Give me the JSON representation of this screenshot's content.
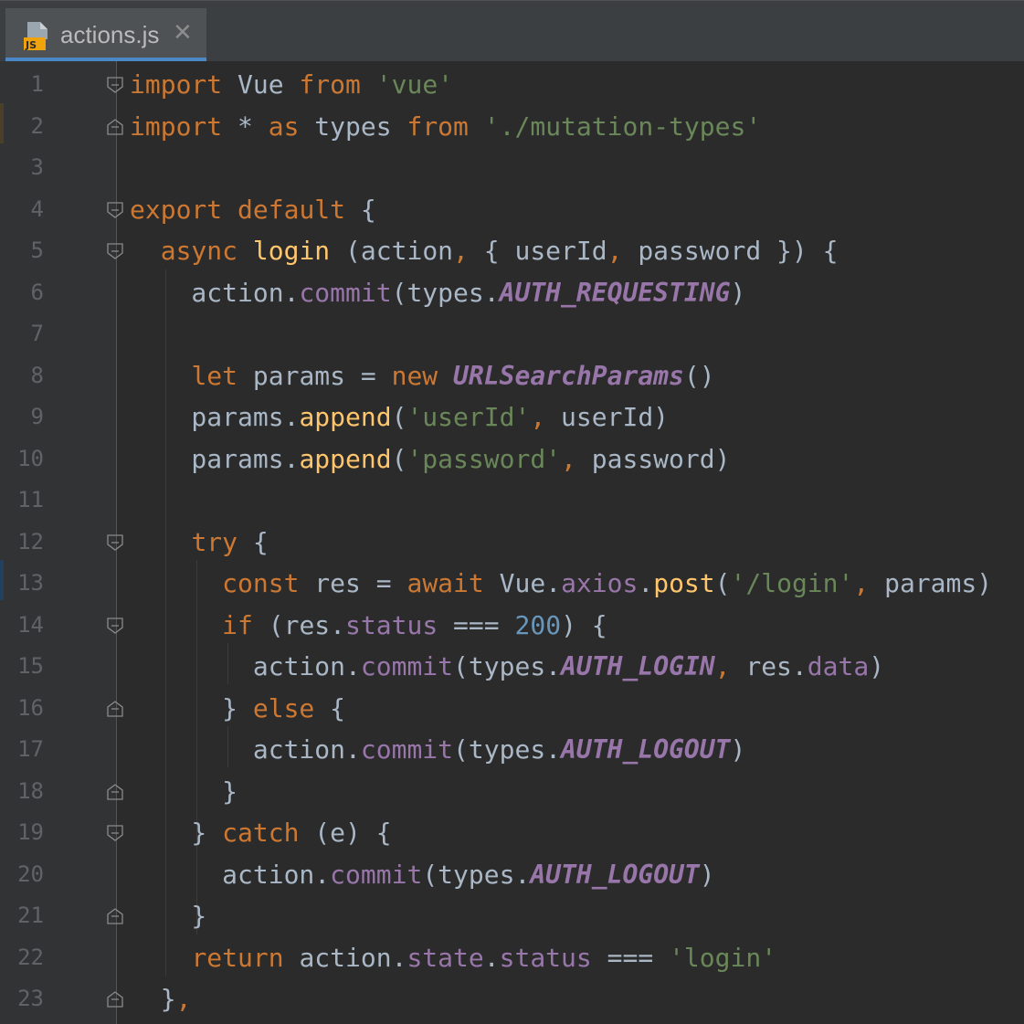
{
  "tab": {
    "title": "actions.js",
    "icon": "javascript-file-icon",
    "icon_badge": "JS",
    "close_glyph": "✕"
  },
  "colors": {
    "background": "#2b2b2b",
    "gutter": "#313335",
    "keyword": "#cc7832",
    "string": "#6a8759",
    "function": "#ffc66d",
    "property": "#9876aa",
    "number": "#6897bb",
    "default_text": "#a9b7c6",
    "tab_underline": "#4a88c7"
  },
  "editor": {
    "lines": [
      {
        "number": "1",
        "fold": "start",
        "tokens": [
          {
            "t": "import",
            "c": "kw"
          },
          {
            "t": " Vue "
          },
          {
            "t": "from",
            "c": "kw"
          },
          {
            "t": " "
          },
          {
            "t": "'vue'",
            "c": "str"
          }
        ]
      },
      {
        "number": "2",
        "fold": "end",
        "tokens": [
          {
            "t": "import",
            "c": "kw"
          },
          {
            "t": " * "
          },
          {
            "t": "as",
            "c": "kw"
          },
          {
            "t": " types "
          },
          {
            "t": "from",
            "c": "kw"
          },
          {
            "t": " "
          },
          {
            "t": "'./mutation-types'",
            "c": "str"
          }
        ]
      },
      {
        "number": "3",
        "fold": "",
        "tokens": []
      },
      {
        "number": "4",
        "fold": "start",
        "tokens": [
          {
            "t": "export",
            "c": "kw"
          },
          {
            "t": " "
          },
          {
            "t": "default",
            "c": "kw"
          },
          {
            "t": " {"
          }
        ]
      },
      {
        "number": "5",
        "fold": "start",
        "tokens": [
          {
            "t": "  "
          },
          {
            "t": "async",
            "c": "kw"
          },
          {
            "t": " "
          },
          {
            "t": "login",
            "c": "fn"
          },
          {
            "t": " (action"
          },
          {
            "t": ",",
            "c": "kw"
          },
          {
            "t": " { userId"
          },
          {
            "t": ",",
            "c": "kw"
          },
          {
            "t": " password }) {"
          }
        ]
      },
      {
        "number": "6",
        "fold": "",
        "tokens": [
          {
            "t": "    action."
          },
          {
            "t": "commit",
            "c": "prop"
          },
          {
            "t": "(types."
          },
          {
            "t": "AUTH_REQUESTING",
            "c": "const"
          },
          {
            "t": ")"
          }
        ]
      },
      {
        "number": "7",
        "fold": "",
        "tokens": []
      },
      {
        "number": "8",
        "fold": "",
        "tokens": [
          {
            "t": "    "
          },
          {
            "t": "let",
            "c": "kw"
          },
          {
            "t": " params = "
          },
          {
            "t": "new",
            "c": "kw"
          },
          {
            "t": " "
          },
          {
            "t": "URLSearchParams",
            "c": "const"
          },
          {
            "t": "()"
          }
        ]
      },
      {
        "number": "9",
        "fold": "",
        "tokens": [
          {
            "t": "    params."
          },
          {
            "t": "append",
            "c": "fn"
          },
          {
            "t": "("
          },
          {
            "t": "'userId'",
            "c": "str"
          },
          {
            "t": ",",
            "c": "kw"
          },
          {
            "t": " userId)"
          }
        ]
      },
      {
        "number": "10",
        "fold": "",
        "tokens": [
          {
            "t": "    params."
          },
          {
            "t": "append",
            "c": "fn"
          },
          {
            "t": "("
          },
          {
            "t": "'password'",
            "c": "str"
          },
          {
            "t": ",",
            "c": "kw"
          },
          {
            "t": " password)"
          }
        ]
      },
      {
        "number": "11",
        "fold": "",
        "tokens": []
      },
      {
        "number": "12",
        "fold": "start",
        "tokens": [
          {
            "t": "    "
          },
          {
            "t": "try",
            "c": "kw"
          },
          {
            "t": " {"
          }
        ]
      },
      {
        "number": "13",
        "fold": "",
        "tokens": [
          {
            "t": "      "
          },
          {
            "t": "const",
            "c": "kw"
          },
          {
            "t": " res = "
          },
          {
            "t": "await",
            "c": "kw"
          },
          {
            "t": " Vue."
          },
          {
            "t": "axios",
            "c": "prop"
          },
          {
            "t": "."
          },
          {
            "t": "post",
            "c": "fn"
          },
          {
            "t": "("
          },
          {
            "t": "'/login'",
            "c": "str"
          },
          {
            "t": ",",
            "c": "kw"
          },
          {
            "t": " params)"
          }
        ]
      },
      {
        "number": "14",
        "fold": "start",
        "tokens": [
          {
            "t": "      "
          },
          {
            "t": "if",
            "c": "kw"
          },
          {
            "t": " (res."
          },
          {
            "t": "status",
            "c": "prop"
          },
          {
            "t": " === "
          },
          {
            "t": "200",
            "c": "num"
          },
          {
            "t": ") {"
          }
        ]
      },
      {
        "number": "15",
        "fold": "",
        "tokens": [
          {
            "t": "        action."
          },
          {
            "t": "commit",
            "c": "prop"
          },
          {
            "t": "(types."
          },
          {
            "t": "AUTH_LOGIN",
            "c": "const"
          },
          {
            "t": ",",
            "c": "kw"
          },
          {
            "t": " res."
          },
          {
            "t": "data",
            "c": "prop"
          },
          {
            "t": ")"
          }
        ]
      },
      {
        "number": "16",
        "fold": "end",
        "tokens": [
          {
            "t": "      } "
          },
          {
            "t": "else",
            "c": "kw"
          },
          {
            "t": " {"
          }
        ]
      },
      {
        "number": "17",
        "fold": "",
        "tokens": [
          {
            "t": "        action."
          },
          {
            "t": "commit",
            "c": "prop"
          },
          {
            "t": "(types."
          },
          {
            "t": "AUTH_LOGOUT",
            "c": "const"
          },
          {
            "t": ")"
          }
        ]
      },
      {
        "number": "18",
        "fold": "end",
        "tokens": [
          {
            "t": "      }"
          }
        ]
      },
      {
        "number": "19",
        "fold": "start",
        "tokens": [
          {
            "t": "    } "
          },
          {
            "t": "catch",
            "c": "kw"
          },
          {
            "t": " (e) {"
          }
        ]
      },
      {
        "number": "20",
        "fold": "",
        "tokens": [
          {
            "t": "      action."
          },
          {
            "t": "commit",
            "c": "prop"
          },
          {
            "t": "(types."
          },
          {
            "t": "AUTH_LOGOUT",
            "c": "const"
          },
          {
            "t": ")"
          }
        ]
      },
      {
        "number": "21",
        "fold": "end",
        "tokens": [
          {
            "t": "    }"
          }
        ]
      },
      {
        "number": "22",
        "fold": "",
        "tokens": [
          {
            "t": "    "
          },
          {
            "t": "return",
            "c": "kw"
          },
          {
            "t": " action."
          },
          {
            "t": "state",
            "c": "prop"
          },
          {
            "t": "."
          },
          {
            "t": "status",
            "c": "prop"
          },
          {
            "t": " === "
          },
          {
            "t": "'login'",
            "c": "str"
          }
        ]
      },
      {
        "number": "23",
        "fold": "end",
        "tokens": [
          {
            "t": "  }"
          },
          {
            "t": ",",
            "c": "kw"
          }
        ]
      }
    ]
  }
}
